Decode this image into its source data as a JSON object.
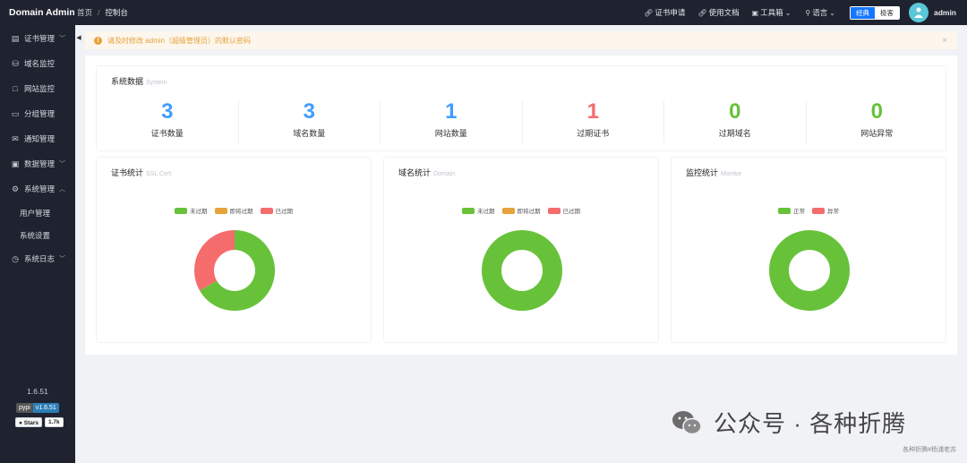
{
  "header": {
    "brand": "Domain Admin",
    "breadcrumb": [
      "首页",
      "控制台"
    ],
    "breadcrumb_sep": "/",
    "links": [
      {
        "label": "证书申请",
        "icon": "link-icon"
      },
      {
        "label": "使用文档",
        "icon": "link-icon"
      },
      {
        "label": "工具箱",
        "icon": "toolbox-icon",
        "dropdown": true
      },
      {
        "label": "语言",
        "icon": "location-icon",
        "dropdown": true
      }
    ],
    "mode_toggle": {
      "options": [
        "经典",
        "极客"
      ],
      "selected": "经典"
    },
    "user": "admin"
  },
  "sidebar": {
    "items": [
      {
        "label": "证书管理",
        "icon": "document-icon",
        "chevron": "﹀"
      },
      {
        "label": "域名监控",
        "icon": "database-icon",
        "chevron": ""
      },
      {
        "label": "网站监控",
        "icon": "monitor-icon",
        "chevron": ""
      },
      {
        "label": "分组管理",
        "icon": "folder-icon",
        "chevron": ""
      },
      {
        "label": "通知管理",
        "icon": "mail-icon",
        "chevron": ""
      },
      {
        "label": "数据管理",
        "icon": "box-icon",
        "chevron": "﹀"
      },
      {
        "label": "系统管理",
        "icon": "gear-icon",
        "chevron": "︿"
      }
    ],
    "sub_items": [
      "用户管理",
      "系统设置"
    ],
    "log_item": {
      "label": "系统日志",
      "icon": "clock-icon",
      "chevron": "﹀"
    },
    "version": "1.6.51",
    "pypi_badge": {
      "left": "pypi",
      "right": "v1.6.51"
    },
    "stars_badge": {
      "left": "Stars",
      "right": "1.7k"
    }
  },
  "alert": {
    "text": "请及时修改 admin（超级管理员）的默认密码",
    "close": "×"
  },
  "system_card": {
    "title": "系统数据",
    "subtitle": "System",
    "stats": [
      {
        "value": "3",
        "label": "证书数量",
        "color": "#409eff"
      },
      {
        "value": "3",
        "label": "域名数量",
        "color": "#409eff"
      },
      {
        "value": "1",
        "label": "网站数量",
        "color": "#409eff"
      },
      {
        "value": "1",
        "label": "过期证书",
        "color": "#f56c6c"
      },
      {
        "value": "0",
        "label": "过期域名",
        "color": "#67c23a"
      },
      {
        "value": "0",
        "label": "网站异常",
        "color": "#67c23a"
      }
    ]
  },
  "charts": [
    {
      "title": "证书统计",
      "subtitle": "SSL Cert"
    },
    {
      "title": "域名统计",
      "subtitle": "Domain"
    },
    {
      "title": "监控统计",
      "subtitle": "Monitor"
    }
  ],
  "chart_data": [
    {
      "type": "pie",
      "categories": [
        "未过期",
        "即将过期",
        "已过期"
      ],
      "values": [
        2,
        0,
        1
      ],
      "colors": [
        "#67c23a",
        "#e6a23c",
        "#f56c6c"
      ],
      "legend": "top"
    },
    {
      "type": "pie",
      "categories": [
        "未过期",
        "即将过期",
        "已过期"
      ],
      "values": [
        3,
        0,
        0
      ],
      "colors": [
        "#67c23a",
        "#e6a23c",
        "#f56c6c"
      ],
      "legend": "top"
    },
    {
      "type": "pie",
      "categories": [
        "正常",
        "异常"
      ],
      "values": [
        1,
        0
      ],
      "colors": [
        "#67c23a",
        "#f56c6c"
      ],
      "legend": "top"
    }
  ],
  "watermark": {
    "text": "公众号 · 各种折腾",
    "sub": "各种折腾#杨浦老苏"
  }
}
